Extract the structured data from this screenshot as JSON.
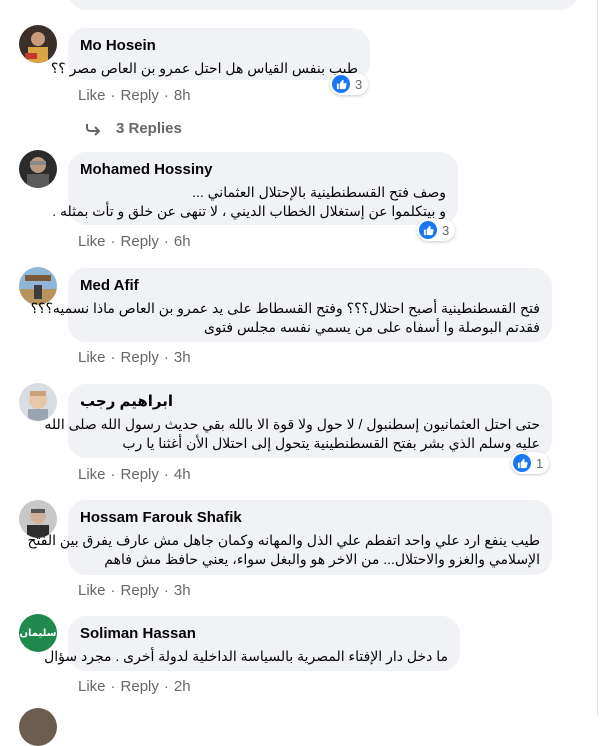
{
  "colors": {
    "bubble": "#f0f2f5",
    "link": "#65676b",
    "like_blue": "#1877f2"
  },
  "actions": {
    "like": "Like",
    "reply": "Reply",
    "separator": "·"
  },
  "comments": [
    {
      "author": "Mo Hosein",
      "lines": [
        "طيب بنفس القياس هل احتل عمرو بن العاص مصر ؟؟"
      ],
      "reactions": "3",
      "time": "8h",
      "replies_label": "3 Replies"
    },
    {
      "author": "Mohamed Hossiny",
      "lines": [
        "وصف فتح القسطنطينية بالإحتلال العثماني ...",
        "و بيتكلموا عن إستغلال الخطاب الديني ، لا تنهى عن خلق و تأت بمثله ."
      ],
      "reactions": "3",
      "time": "6h"
    },
    {
      "author": "Med Afif",
      "lines": [
        "فتح القسطنطينية أصبح احتلال؟؟؟ وفتح القسطاط على يد عمرو بن العاص ماذا نسميه؟؟؟",
        "فقدتم البوصلة وا أسفاه على من يسمي نفسه مجلس فتوى"
      ],
      "time": "3h"
    },
    {
      "author": "ابراهيم رجب",
      "lines": [
        "حتى احتل العثمانيون إسطنبول / لا حول ولا قوة الا بالله بقي حديث رسول الله صلى الله",
        "عليه وسلم الذي بشر بفتح القسطنطينية يتحول إلى احتلال الأن أغثنا يا رب"
      ],
      "reactions": "1",
      "time": "4h"
    },
    {
      "author": "Hossam Farouk Shafik",
      "lines": [
        "طيب ينفع ارد علي واحد اتفطم علي الذل والمهانه وكمان جاهل مش عارف يفرق بين الفتح",
        "الإسلامي والغزو والاحتلال... من الاخر هو والبغل سواء، يعني حافظ مش فاهم"
      ],
      "time": "3h"
    },
    {
      "author": "Soliman Hassan",
      "avatar_text": "سليمان",
      "lines": [
        "ما دخل دار الإفتاء المصرية بالسياسة الداخلية لدولة أخرى . مجرد سؤال"
      ],
      "time": "2h"
    }
  ]
}
